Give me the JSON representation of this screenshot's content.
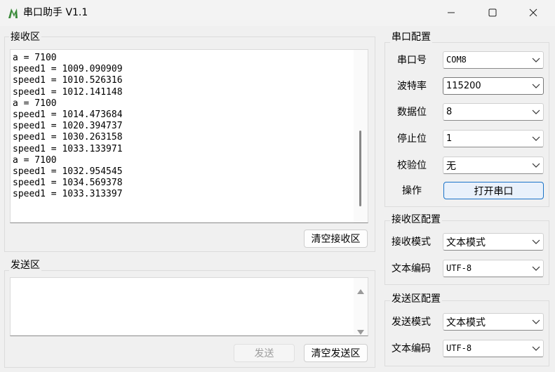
{
  "window": {
    "title": "串口助手 V1.1",
    "minimize_icon": "minimize-icon",
    "maximize_icon": "maximize-icon",
    "close_icon": "close-icon"
  },
  "receive": {
    "group_label": "接收区",
    "lines": [
      "a = 7100",
      "speed1 = 1009.090909",
      "speed1 = 1010.526316",
      "speed1 = 1012.141148",
      "a = 7100",
      "speed1 = 1014.473684",
      "speed1 = 1020.394737",
      "speed1 = 1030.263158",
      "speed1 = 1033.133971",
      "a = 7100",
      "speed1 = 1032.954545",
      "speed1 = 1034.569378",
      "speed1 = 1033.313397"
    ],
    "clear_button": "清空接收区"
  },
  "send": {
    "group_label": "发送区",
    "text": "",
    "send_button": "发送",
    "clear_button": "清空发送区"
  },
  "serial_config": {
    "group_label": "串口配置",
    "port_label": "串口号",
    "port_value": "COM8",
    "baud_label": "波特率",
    "baud_value": "115200",
    "databits_label": "数据位",
    "databits_value": "8",
    "stopbits_label": "停止位",
    "stopbits_value": "1",
    "parity_label": "校验位",
    "parity_value": "无",
    "operate_label": "操作",
    "open_button": "打开串口"
  },
  "receive_config": {
    "group_label": "接收区配置",
    "mode_label": "接收模式",
    "mode_value": "文本模式",
    "encoding_label": "文本编码",
    "encoding_value": "UTF-8"
  },
  "send_config": {
    "group_label": "发送区配置",
    "mode_label": "发送模式",
    "mode_value": "文本模式",
    "encoding_label": "文本编码",
    "encoding_value": "UTF-8"
  },
  "colors": {
    "accent": "#1a73c8",
    "window_bg": "#f0f0f0"
  }
}
